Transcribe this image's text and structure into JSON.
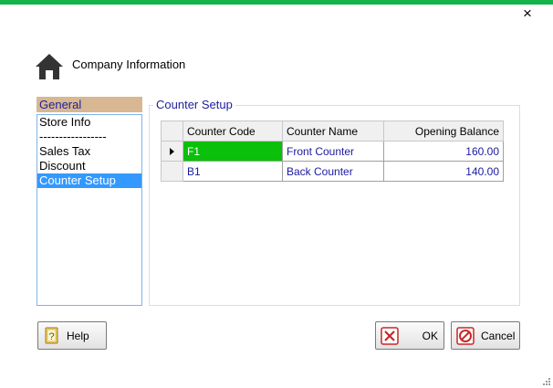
{
  "window": {
    "close_glyph": "×",
    "accent_color": "#14b24a"
  },
  "header": {
    "title": "Company Information",
    "icon": "home-icon"
  },
  "nav": {
    "section_label": "General",
    "items": [
      {
        "label": "Store Info",
        "selected": false
      },
      {
        "label": "-----------------",
        "selected": false
      },
      {
        "label": "Sales Tax",
        "selected": false
      },
      {
        "label": "Discount",
        "selected": false
      },
      {
        "label": "Counter Setup",
        "selected": true
      }
    ]
  },
  "counter_setup": {
    "group_title": "Counter Setup",
    "columns": [
      "Counter Code",
      "Counter Name",
      "Opening Balance"
    ],
    "rows": [
      {
        "code": "F1",
        "name": "Front Counter",
        "balance": "160.00",
        "current": true
      },
      {
        "code": "B1",
        "name": "Back Counter",
        "balance": "140.00",
        "current": false
      }
    ]
  },
  "buttons": {
    "help": {
      "label": "Help",
      "icon": "help-book-icon"
    },
    "ok": {
      "label": "OK",
      "icon": "ok-x-icon"
    },
    "cancel": {
      "label": "Cancel",
      "icon": "cancel-circle-icon"
    }
  }
}
